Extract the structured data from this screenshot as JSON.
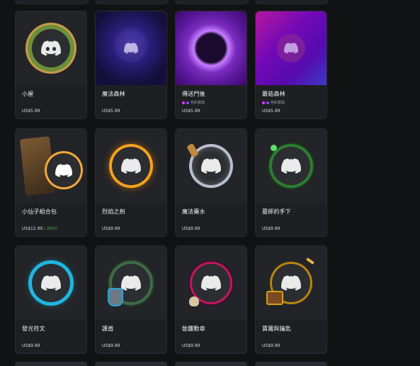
{
  "colors": {
    "page_bg": "#111214",
    "card_bg": "#1e1f22",
    "discount_green": "#3ba55d"
  },
  "icons": {
    "avatar": "discord-logo-icon",
    "badge_dots": "color-dots-icon"
  },
  "products": [
    {
      "name": "小屋",
      "price": "US$5.99"
    },
    {
      "name": "魔法森林",
      "price": "US$5.99"
    },
    {
      "name": "傳送門後",
      "badge": "色彩變換",
      "price": "US$5.99"
    },
    {
      "name": "蘑菇森林",
      "badge": "色彩變換",
      "price": "US$5.99"
    },
    {
      "name": "小仙子組合包",
      "price": "US$12.99",
      "discount": "(-28%)"
    },
    {
      "name": "烈焰之劍",
      "price": "US$9.99"
    },
    {
      "name": "魔法藥水",
      "price": "US$9.99"
    },
    {
      "name": "墓師的手下",
      "price": "US$9.99"
    },
    {
      "name": "發光符文",
      "price": "US$9.99"
    },
    {
      "name": "護盾",
      "price": "US$9.99"
    },
    {
      "name": "骷髏勳章",
      "price": "US$9.99"
    },
    {
      "name": "寶藏與鑰匙",
      "price": "US$9.99"
    }
  ]
}
